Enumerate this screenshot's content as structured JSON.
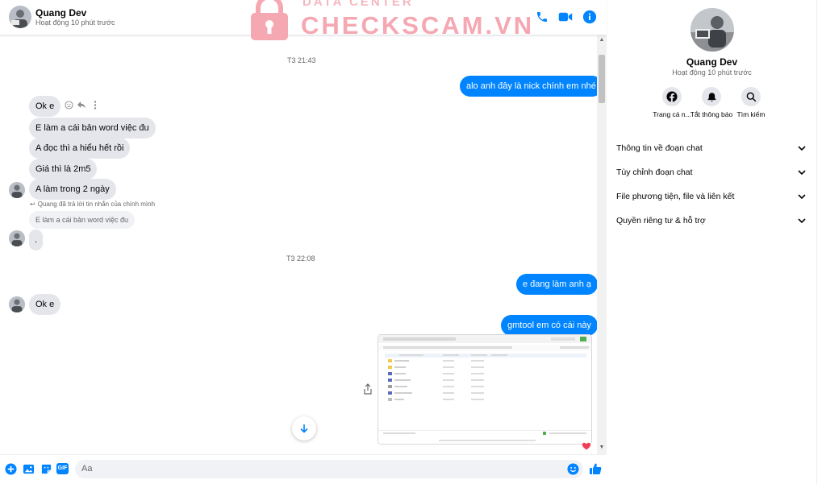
{
  "colors": {
    "accent": "#0084ff",
    "incoming": "#e4e6eb",
    "muted": "#65676b",
    "heart": "#f33e58",
    "watermark": "#f5a7b2"
  },
  "watermark": {
    "top": "DATA CENTER",
    "main": "CHECKSCAM.VN"
  },
  "header": {
    "name": "Quang Dev",
    "status": "Hoạt động 10 phút trước",
    "icons": [
      "phone-icon",
      "video-icon",
      "info-icon"
    ]
  },
  "messages": {
    "time1": "T3 21:43",
    "out1": "alo anh đây là nick chính em nhé",
    "in1": "Ok e",
    "in2": "E làm a cái bản word việc đu",
    "in3": "A đọc thì a hiểu hết rồi",
    "in4": "Giá thì là 2m5",
    "in5": "A làm trong 2 ngày",
    "reply_note": "Quang đã trả lời tin nhắn của chính mình",
    "reply_quote": "E làm a cái bản word việc đu",
    "in6": ".",
    "time2": "T3 22:08",
    "out2": "e đang làm anh ạ",
    "in7": "Ok e",
    "out3": "gmtool em có cái này"
  },
  "composer": {
    "placeholder": "Aa",
    "gif_label": "GIF"
  },
  "info": {
    "name": "Quang Dev",
    "status": "Hoạt động 10 phút trước",
    "actions": [
      {
        "label": "Trang cá n...",
        "icon": "facebook-icon"
      },
      {
        "label": "Tắt thông báo",
        "icon": "bell-icon"
      },
      {
        "label": "Tìm kiếm",
        "icon": "search-icon"
      }
    ],
    "sections": [
      "Thông tin về đoạn chat",
      "Tùy chỉnh đoạn chat",
      "File phương tiện, file và liên kết",
      "Quyền riêng tư & hỗ trợ"
    ]
  }
}
